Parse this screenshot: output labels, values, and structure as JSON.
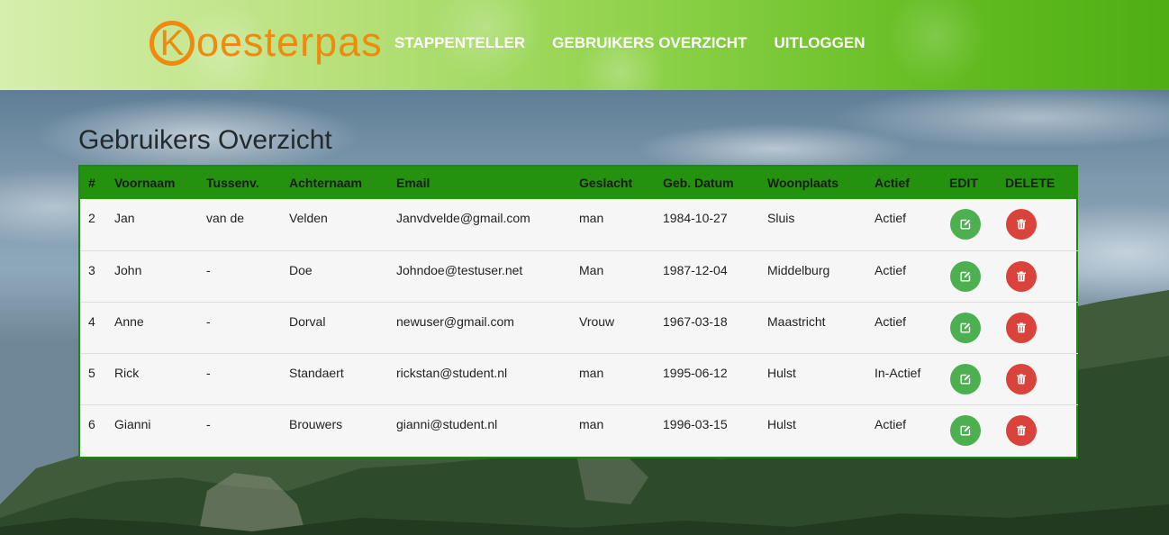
{
  "header": {
    "logo_initial": "K",
    "logo_rest": "oesterpas",
    "nav": [
      "STAPPENTELLER",
      "GEBRUIKERS OVERZICHT",
      "UITLOGGEN"
    ]
  },
  "page": {
    "title": "Gebruikers Overzicht"
  },
  "table": {
    "columns": [
      "#",
      "Voornaam",
      "Tussenv.",
      "Achternaam",
      "Email",
      "Geslacht",
      "Geb. Datum",
      "Woonplaats",
      "Actief",
      "EDIT",
      "DELETE"
    ],
    "rows": [
      {
        "id": "2",
        "voornaam": "Jan",
        "tussenv": "van de",
        "achternaam": "Velden",
        "email": "Janvdvelde@gmail.com",
        "geslacht": "man",
        "geb_datum": "1984-10-27",
        "woonplaats": "Sluis",
        "actief": "Actief"
      },
      {
        "id": "3",
        "voornaam": "John",
        "tussenv": "-",
        "achternaam": "Doe",
        "email": "Johndoe@testuser.net",
        "geslacht": "Man",
        "geb_datum": "1987-12-04",
        "woonplaats": "Middelburg",
        "actief": "Actief"
      },
      {
        "id": "4",
        "voornaam": "Anne",
        "tussenv": "-",
        "achternaam": "Dorval",
        "email": "newuser@gmail.com",
        "geslacht": "Vrouw",
        "geb_datum": "1967-03-18",
        "woonplaats": "Maastricht",
        "actief": "Actief"
      },
      {
        "id": "5",
        "voornaam": "Rick",
        "tussenv": "-",
        "achternaam": "Standaert",
        "email": "rickstan@student.nl",
        "geslacht": "man",
        "geb_datum": "1995-06-12",
        "woonplaats": "Hulst",
        "actief": "In-Actief"
      },
      {
        "id": "6",
        "voornaam": "Gianni",
        "tussenv": "-",
        "achternaam": "Brouwers",
        "email": "gianni@student.nl",
        "geslacht": "man",
        "geb_datum": "1996-03-15",
        "woonplaats": "Hulst",
        "actief": "Actief"
      }
    ]
  },
  "icons": {
    "edit": "edit-icon",
    "delete": "trash-icon"
  },
  "colors": {
    "brand_orange": "#f08a0e",
    "table_header_green": "#24910f",
    "table_border_green": "#1c8a0c",
    "edit_green": "#4caf50",
    "delete_red": "#d9433b"
  }
}
